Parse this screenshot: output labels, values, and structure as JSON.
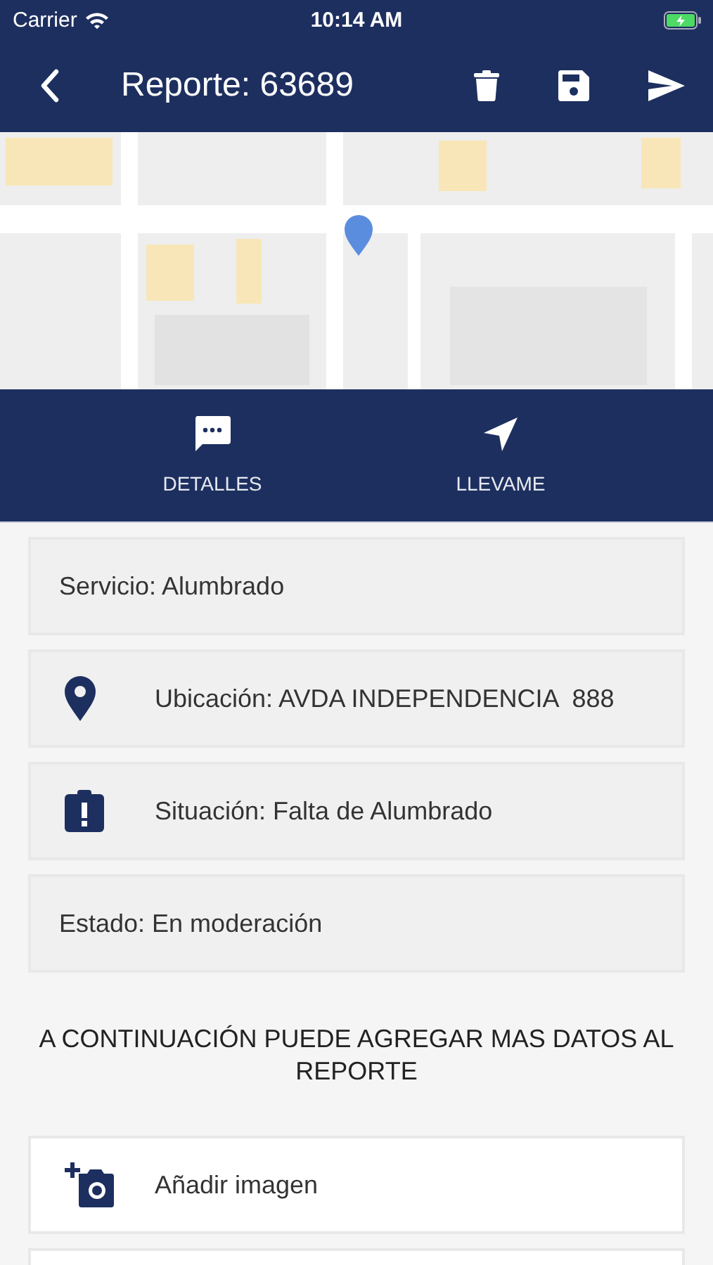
{
  "status_bar": {
    "carrier": "Carrier",
    "time": "10:14 AM"
  },
  "header": {
    "title": "Reporte: 63689"
  },
  "tabs": [
    {
      "label": "DETALLES",
      "kind": "details"
    },
    {
      "label": "LLEVAME",
      "kind": "navigate"
    }
  ],
  "details": [
    {
      "kind": "plain",
      "text": "Servicio: Alumbrado"
    },
    {
      "kind": "location",
      "text": "Ubicación: AVDA INDEPENDENCIA  888"
    },
    {
      "kind": "clipboard",
      "text": "Situación: Falta de Alumbrado"
    },
    {
      "kind": "plain",
      "text": "Estado: En moderación"
    }
  ],
  "prompt": "A CONTINUACIÓN PUEDE AGREGAR MAS DATOS AL REPORTE",
  "actions": [
    {
      "kind": "add_image",
      "label": "Añadir imagen"
    }
  ]
}
